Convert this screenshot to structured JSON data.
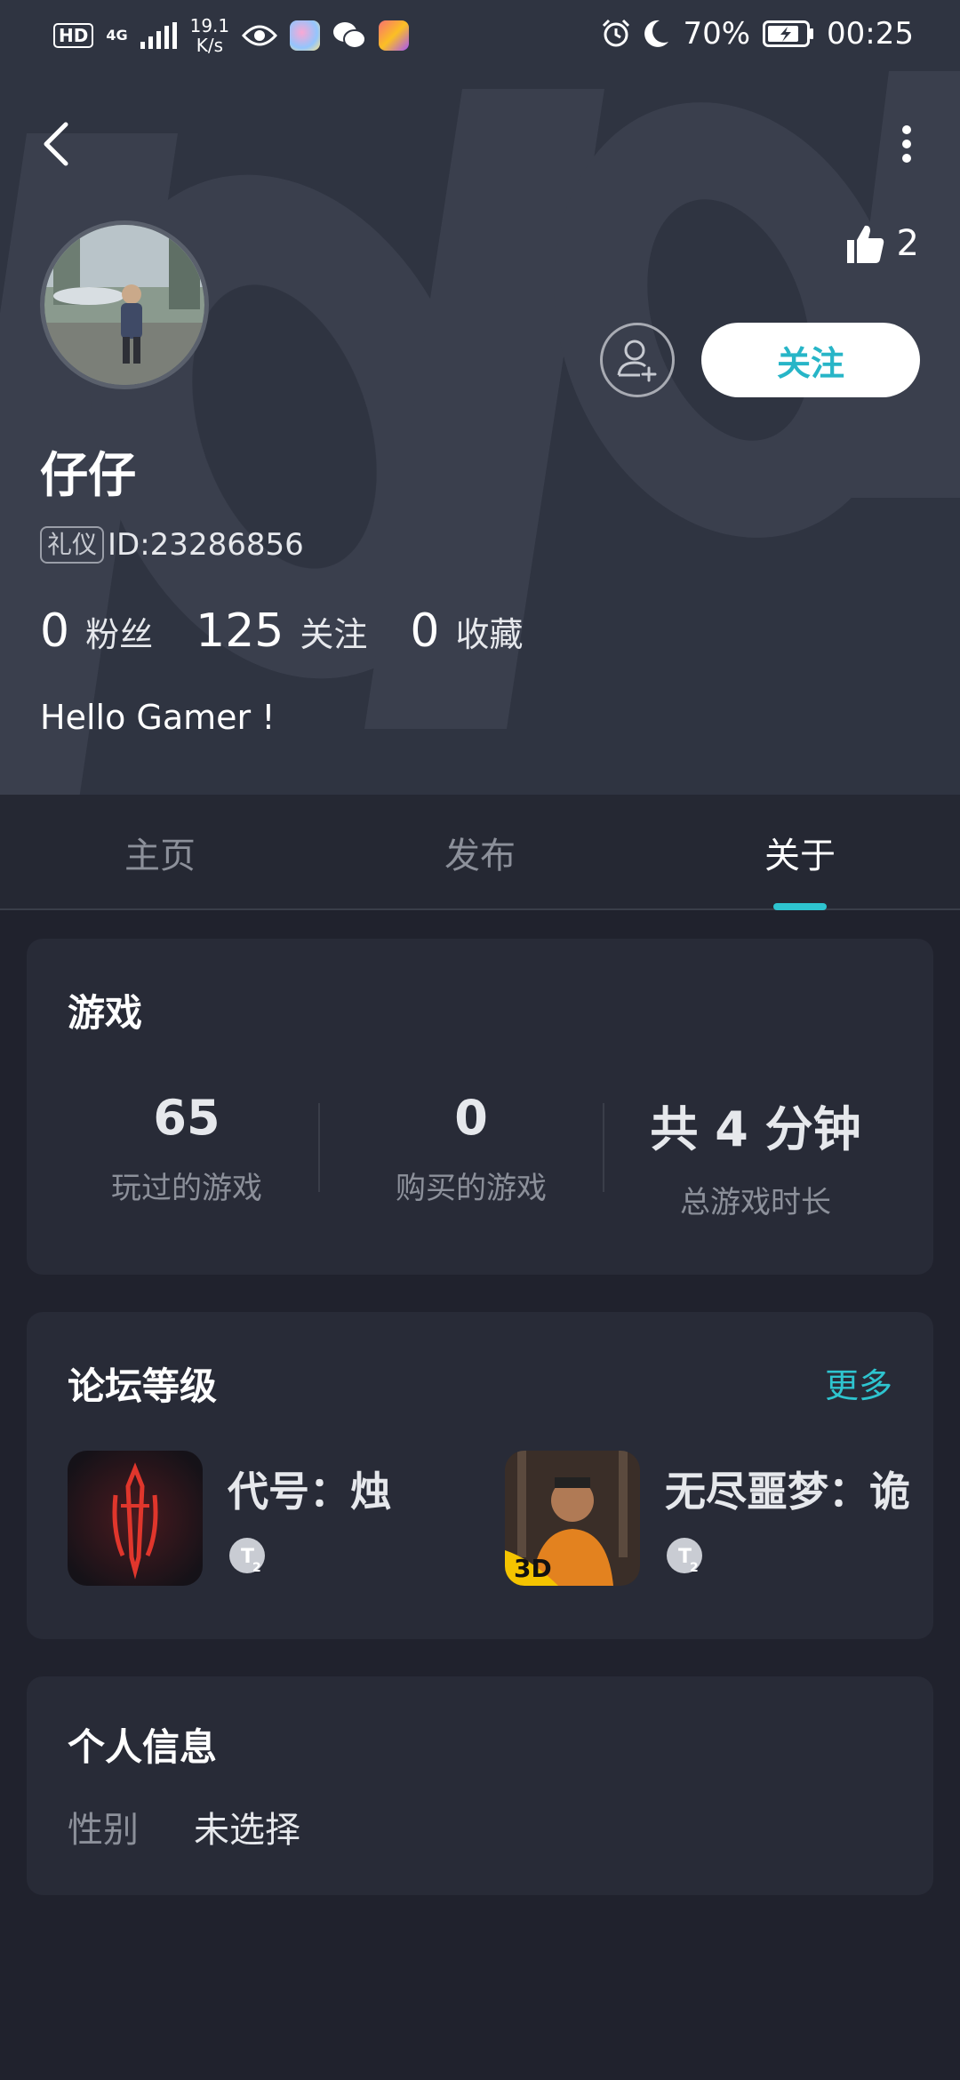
{
  "status_bar": {
    "hd": "HD",
    "network": "4G",
    "speed_value": "19.1",
    "speed_unit": "K/s",
    "battery": "70%",
    "time": "00:25"
  },
  "profile": {
    "username": "仔仔",
    "etiquette_badge": "礼仪",
    "id_text": "ID:23286856",
    "likes": "2",
    "follow_label": "关注",
    "bio": "Hello Gamer !",
    "stats": [
      {
        "value": "0",
        "label": "粉丝"
      },
      {
        "value": "125",
        "label": "关注"
      },
      {
        "value": "0",
        "label": "收藏"
      }
    ]
  },
  "tabs": [
    {
      "label": "主页",
      "active": false
    },
    {
      "label": "发布",
      "active": false
    },
    {
      "label": "关于",
      "active": true
    }
  ],
  "games_card": {
    "title": "游戏",
    "stats": [
      {
        "value": "65",
        "label": "玩过的游戏"
      },
      {
        "value": "0",
        "label": "购买的游戏"
      },
      {
        "value": "共 4 分钟",
        "label": "总游戏时长"
      }
    ]
  },
  "forum_card": {
    "title": "论坛等级",
    "more_label": "更多",
    "items": [
      {
        "name": "代号：烛",
        "level_badge": "T2"
      },
      {
        "name": "无尽噩梦：诡",
        "icon_badge": "3D",
        "level_badge": "T2"
      }
    ]
  },
  "personal_card": {
    "title": "个人信息",
    "gender_label": "性别",
    "gender_value": "未选择"
  },
  "colors": {
    "accent": "#2ec4cf",
    "background": "#20222d",
    "header": "#2f3441",
    "card": "#282b37"
  }
}
